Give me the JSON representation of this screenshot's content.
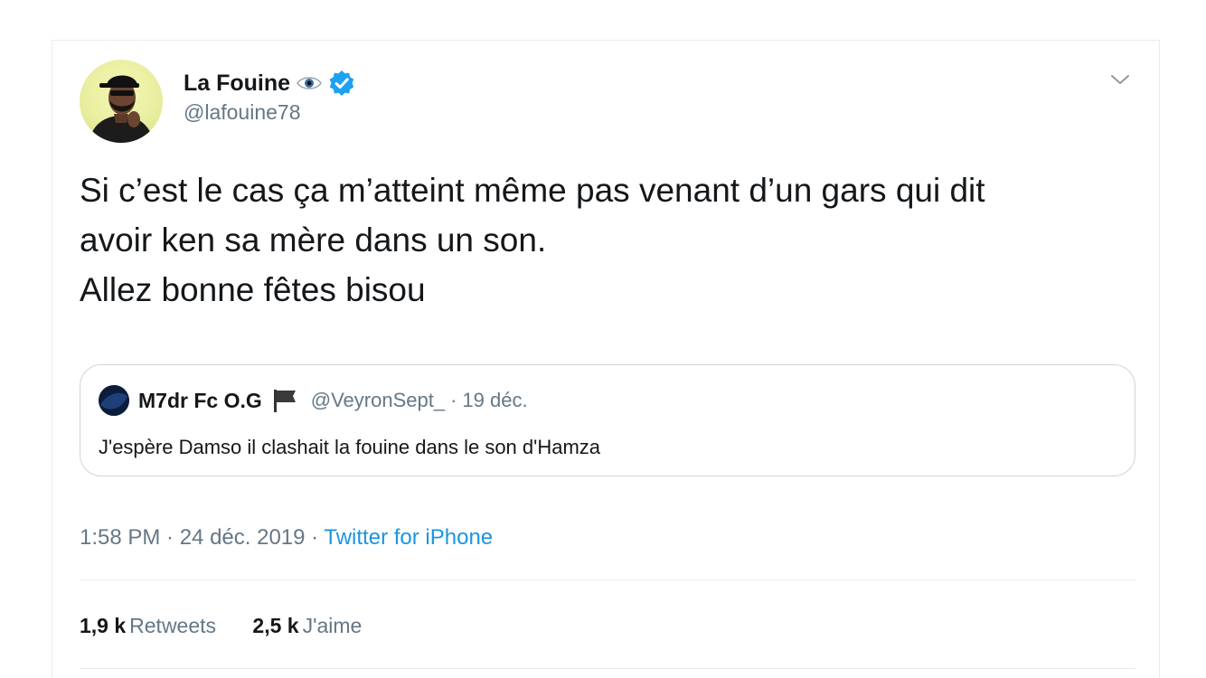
{
  "tweet": {
    "author": {
      "display_name": "La Fouine",
      "handle": "@lafouine78",
      "verified": true,
      "name_emoji": "eye-icon"
    },
    "text_lines": [
      "Si c’est le cas ça m’atteint même pas venant d’un gars qui dit",
      "avoir ken sa mère dans un son.",
      "Allez bonne fêtes bisou"
    ],
    "quoted": {
      "display_name": "M7dr Fc O.G",
      "name_emoji": "flag-icon",
      "handle": "@VeyronSept_",
      "separator": "·",
      "date": "19 déc.",
      "text": "J'espère Damso il clashait la fouine dans le son d'Hamza"
    },
    "timestamp": "1:58 PM · 24 déc. 2019 · ",
    "source": "Twitter for iPhone",
    "stats": {
      "retweets_count": "1,9 k",
      "retweets_label": "Retweets",
      "likes_count": "2,5 k",
      "likes_label": "J'aime"
    }
  },
  "colors": {
    "text_primary": "#14171a",
    "text_secondary": "#657786",
    "link": "#1b95e0",
    "verified": "#1da1f2",
    "border": "#e6ecf0"
  }
}
